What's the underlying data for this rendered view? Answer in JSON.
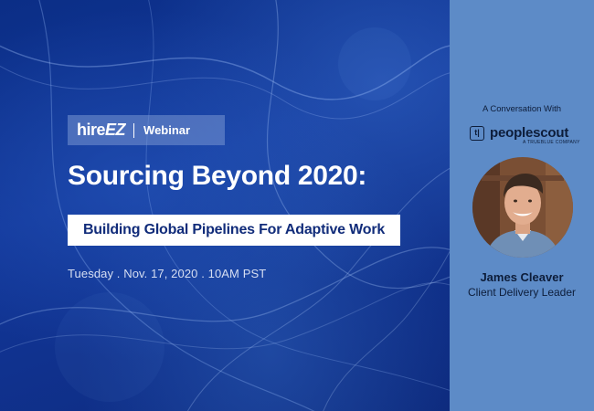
{
  "brand": {
    "logo": "hireEZ",
    "logo_main": "hire",
    "logo_accent": "EZ",
    "tag": "Webinar"
  },
  "headline": "Sourcing Beyond 2020:",
  "subheadline": "Building Global Pipelines For Adaptive Work",
  "date_line": "Tuesday . Nov. 17, 2020 . 10AM PST",
  "intro": "A Conversation With",
  "partner": {
    "name": "peoplescout",
    "tagline": "A TRUEBLUE COMPANY",
    "icon_glyph": "t|"
  },
  "speaker": {
    "name": "James Cleaver",
    "title": "Client Delivery Leader"
  },
  "colors": {
    "left_panel": "#12379a",
    "right_panel": "#5d8bc7",
    "subhead_text": "#112c7a",
    "dark_text": "#0d1d3a"
  }
}
